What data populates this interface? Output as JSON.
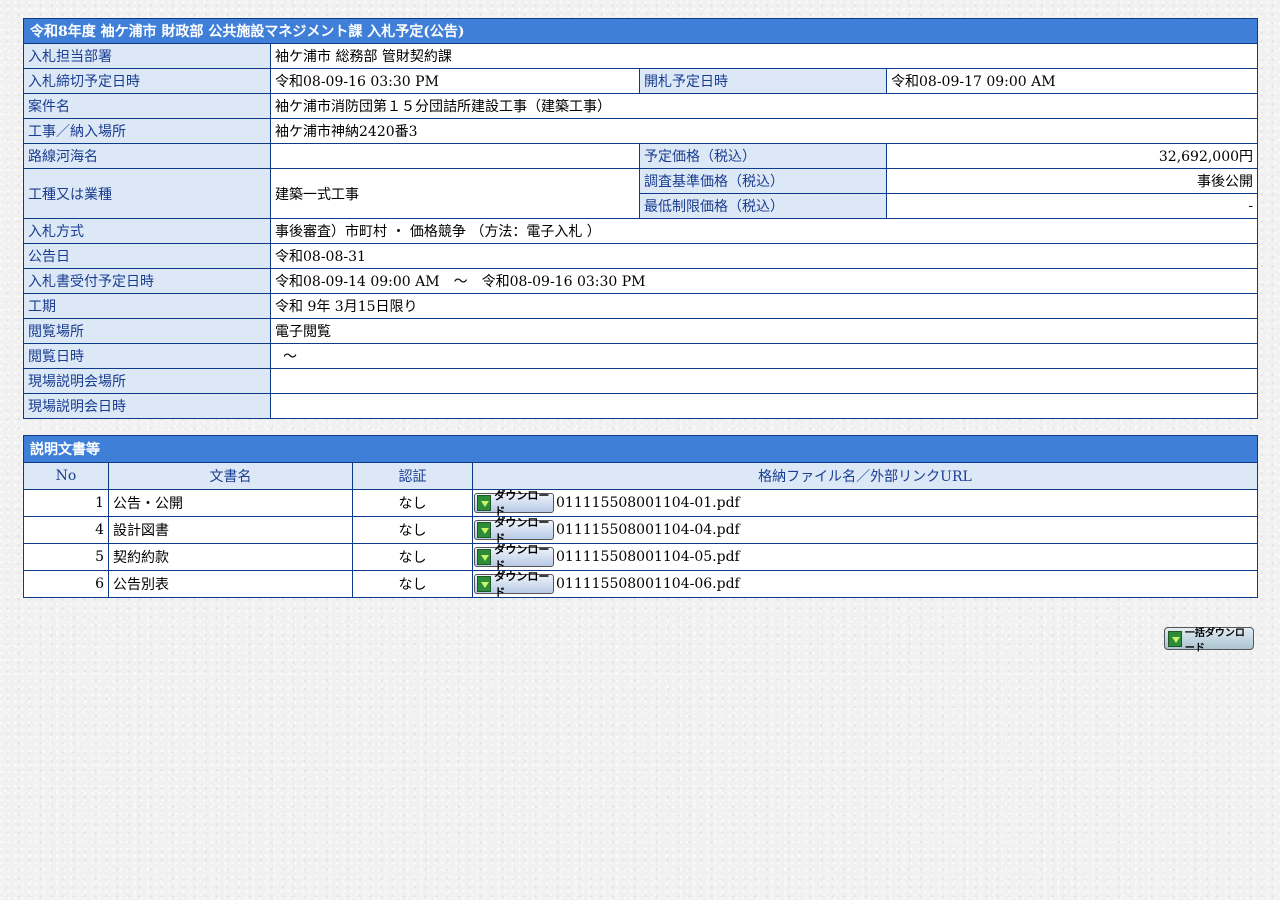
{
  "notice": {
    "title": "令和8年度 袖ケ浦市 財政部 公共施設マネジメント課 入札予定(公告)",
    "rows": {
      "dept_label": "入札担当部署",
      "dept_value": "袖ケ浦市 総務部 管財契約課",
      "deadline_label": "入札締切予定日時",
      "deadline_value": "令和08-09-16 03:30 PM",
      "opening_label": "開札予定日時",
      "opening_value": "令和08-09-17 09:00 AM",
      "case_label": "案件名",
      "case_value": "袖ケ浦市消防団第１５分団詰所建設工事（建築工事）",
      "place_label": "工事／納入場所",
      "place_value": "袖ケ浦市神納2420番3",
      "route_label": "路線河海名",
      "route_value": "",
      "price_label": "予定価格（税込）",
      "price_value": "32,692,000円",
      "type_label": "工種又は業種",
      "type_value": "建築一式工事",
      "survey_label": "調査基準価格（税込）",
      "survey_value": "事後公開",
      "min_label": "最低制限価格（税込）",
      "min_value": "-",
      "method_label": "入札方式",
      "method_value": "事後審査）市町村 ・ 価格競争 （方法：電子入札 ）",
      "announce_label": "公告日",
      "announce_value": "令和08-08-31",
      "accept_label": "入札書受付予定日時",
      "accept_value": "令和08-09-14 09:00 AM　～　令和08-09-16 03:30 PM",
      "period_label": "工期",
      "period_value": "令和 9年 3月15日限り",
      "view_place_label": "閲覧場所",
      "view_place_value": "電子閲覧",
      "view_date_label": "閲覧日時",
      "view_date_value": "～",
      "site_place_label": "現場説明会場所",
      "site_place_value": "",
      "site_date_label": "現場説明会日時",
      "site_date_value": ""
    }
  },
  "documents": {
    "title": "説明文書等",
    "headers": {
      "no": "No",
      "name": "文書名",
      "auth": "認証",
      "file": "格納ファイル名／外部リンクURL"
    },
    "download_label": "ダウンロード",
    "items": [
      {
        "no": "1",
        "name": "公告・公開",
        "auth": "なし",
        "file": "011115508001104-01.pdf"
      },
      {
        "no": "4",
        "name": "設計図書",
        "auth": "なし",
        "file": "011115508001104-04.pdf"
      },
      {
        "no": "5",
        "name": "契約約款",
        "auth": "なし",
        "file": "011115508001104-05.pdf"
      },
      {
        "no": "6",
        "name": "公告別表",
        "auth": "なし",
        "file": "011115508001104-06.pdf"
      }
    ]
  },
  "bulk_download_label": "一括ダウンロード"
}
